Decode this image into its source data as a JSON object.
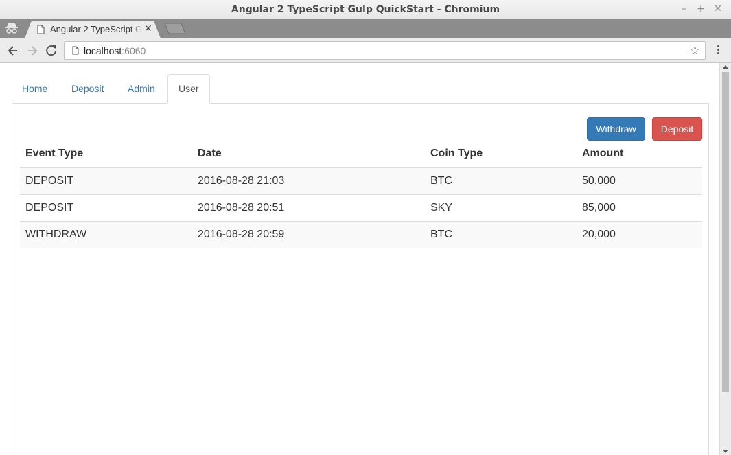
{
  "window": {
    "title": "Angular 2 TypeScript Gulp QuickStart - Chromium",
    "minimize_glyph": "–",
    "maximize_glyph": "+",
    "close_glyph": "✕"
  },
  "browser": {
    "tab_title": "Angular 2 TypeScript Gulp QuickStart",
    "tab_close_glyph": "✕",
    "url_host": "localhost",
    "url_port": ":6060",
    "bookmark_glyph": "☆"
  },
  "nav": {
    "tabs": [
      {
        "label": "Home",
        "active": false
      },
      {
        "label": "Deposit",
        "active": false
      },
      {
        "label": "Admin",
        "active": false
      },
      {
        "label": "User",
        "active": true
      }
    ]
  },
  "actions": {
    "withdraw_label": "Withdraw",
    "deposit_label": "Deposit",
    "withdraw_color": "#337ab7",
    "deposit_color": "#d9534f"
  },
  "table": {
    "headers": [
      "Event Type",
      "Date",
      "Coin Type",
      "Amount"
    ],
    "rows": [
      [
        "DEPOSIT",
        "2016-08-28 21:03",
        "BTC",
        "50,000"
      ],
      [
        "DEPOSIT",
        "2016-08-28 20:51",
        "SKY",
        "85,000"
      ],
      [
        "WITHDRAW",
        "2016-08-28 20:59",
        "BTC",
        "20,000"
      ]
    ]
  }
}
